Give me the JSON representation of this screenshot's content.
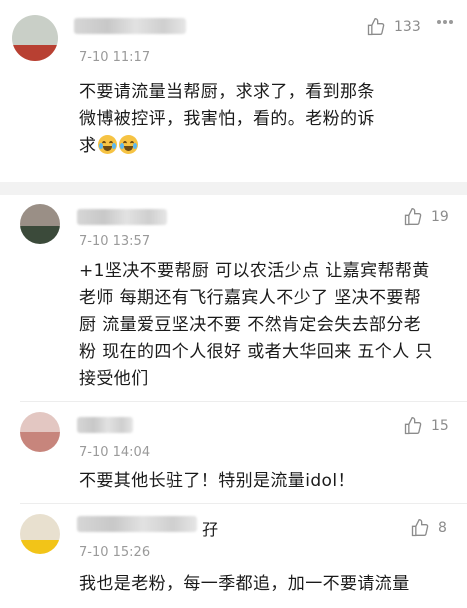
{
  "comments": [
    {
      "time": "7-10 11:17",
      "likes": "133",
      "text_lines": [
        "不要请流量当帮厨，求求了，看到那条",
        "微博被控评，我害怕，看的。老粉的诉",
        "求"
      ],
      "avatar_colors": [
        "#c9cfc7",
        "#b84032"
      ]
    },
    {
      "time": "7-10 13:57",
      "likes": "19",
      "text_lines": [
        "+1坚决不要帮厨 可以农活少点 让嘉宾帮帮黄",
        "老师 每期还有飞行嘉宾人不少了 坚决不要帮",
        "厨 流量爱豆坚决不要 不然肯定会失去部分老",
        "粉 现在的四个人很好 或者大华回来 五个人 只",
        "接受他们"
      ],
      "avatar_colors": [
        "#9a8f86",
        "#3b4a3a"
      ]
    },
    {
      "time": "7-10 14:04",
      "likes": "15",
      "text_lines": [
        "不要其他长驻了！特别是流量idol！"
      ],
      "avatar_colors": [
        "#e3c7c2",
        "#c7857c"
      ]
    },
    {
      "time": "7-10 15:26",
      "likes": "8",
      "name_tail": "孖",
      "text_lines": [
        "我也是老粉，每一季都追，加一不要请流量"
      ],
      "avatar_colors": [
        "#e8e0cf",
        "#f2c418"
      ]
    }
  ]
}
